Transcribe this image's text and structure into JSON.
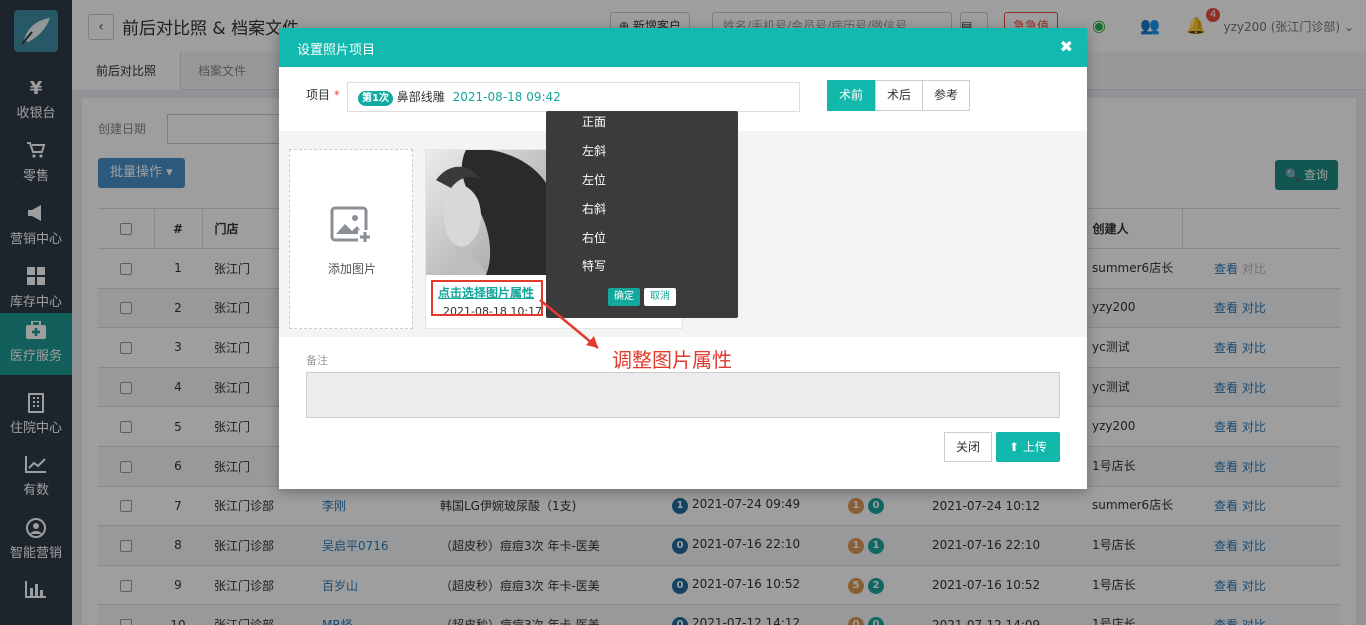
{
  "sidebar": {
    "items": [
      {
        "label": "收银台",
        "glyph": "¥"
      },
      {
        "label": "零售",
        "glyph": "🛒"
      },
      {
        "label": "营销中心",
        "glyph": "📢"
      },
      {
        "label": "库存中心",
        "glyph": "▦"
      },
      {
        "label": "医疗服务",
        "glyph": "✚"
      },
      {
        "label": "住院中心",
        "glyph": "🏢"
      },
      {
        "label": "有数",
        "glyph": "📈"
      },
      {
        "label": "智能营销",
        "glyph": "⚙"
      },
      {
        "label": "",
        "glyph": "📊"
      }
    ]
  },
  "topbar": {
    "title": "前后对比照 & 档案文件",
    "new_customer_label": "新增客户",
    "search_placeholder": "姓名/手机号/会员号/病历号/微信号",
    "emergency_label": "急急值",
    "notification_count": "4",
    "user": "yzy200 (张江门诊部)"
  },
  "tabs": [
    "前后对比照",
    "档案文件"
  ],
  "filter": {
    "created_date_label": "创建日期"
  },
  "toolbar": {
    "batch_label": "批量操作",
    "query_label": "查询"
  },
  "table": {
    "headers": [
      "",
      "#",
      "门店",
      "",
      "",
      "",
      "",
      "",
      "创建人",
      ""
    ],
    "rows": [
      {
        "no": "1",
        "store": "张江门",
        "creator": "summer6店长"
      },
      {
        "no": "2",
        "store": "张江门",
        "creator": "yzy200"
      },
      {
        "no": "3",
        "store": "张江门",
        "creator": "yc测试"
      },
      {
        "no": "4",
        "store": "张江门",
        "creator": "yc测试"
      },
      {
        "no": "5",
        "store": "张江门",
        "creator": "yzy200"
      },
      {
        "no": "6",
        "store": "张江门",
        "creator": "1号店长"
      },
      {
        "no": "7",
        "store": "张江门诊部",
        "customer": "李刚",
        "project": "韩国LG伊婉玻尿酸（1支)",
        "count": "1",
        "date1": "2021-07-24 09:49",
        "b1": "1",
        "b2": "0",
        "date2": "2021-07-24 10:12",
        "creator": "summer6店长"
      },
      {
        "no": "8",
        "store": "张江门诊部",
        "customer": "吴启平0716",
        "project": "（超皮秒）痘痘3次 年卡-医美",
        "count": "0",
        "date1": "2021-07-16 22:10",
        "b1": "1",
        "b2": "1",
        "date2": "2021-07-16 22:10",
        "creator": "1号店长"
      },
      {
        "no": "9",
        "store": "张江门诊部",
        "customer": "百岁山",
        "project": "（超皮秒）痘痘3次 年卡-医美",
        "count": "0",
        "date1": "2021-07-16 10:52",
        "b1": "5",
        "b2": "2",
        "date2": "2021-07-16 10:52",
        "creator": "1号店长"
      },
      {
        "no": "10",
        "store": "张江门诊部",
        "customer": "MR怪",
        "project": "（超皮秒）痘痘3次 年卡-医美",
        "count": "0",
        "date1": "2021-07-12 14:12",
        "b1": "0",
        "b2": "0",
        "date2": "2021-07-12 14:09",
        "creator": "1号店长"
      }
    ],
    "view_label": "查看",
    "compare_label": "对比"
  },
  "modal": {
    "title": "设置照片项目",
    "project_label": "项目",
    "required_mark": "*",
    "project_badge": "第1次",
    "project_name": "鼻部线雕",
    "project_date": "2021-08-18 09:42",
    "segments": [
      "术前",
      "术后",
      "参考"
    ],
    "active_segment": "术前",
    "add_image_label": "添加图片",
    "photo_link": "点击选择图片属性",
    "photo_date": "2021-08-18 10:17",
    "angle_options": [
      "正面",
      "左斜",
      "左位",
      "右斜",
      "右位",
      "特写"
    ],
    "confirm_label": "确定",
    "cancel_label": "取消",
    "remark_label": "备注",
    "close_label": "关闭",
    "upload_label": "上传"
  },
  "annotation": {
    "text": "调整图片属性",
    "color": "#e23b2e"
  },
  "colors": {
    "teal": "#13b8ad",
    "sidebar": "#2e3a48",
    "link": "#2a7ab8"
  }
}
